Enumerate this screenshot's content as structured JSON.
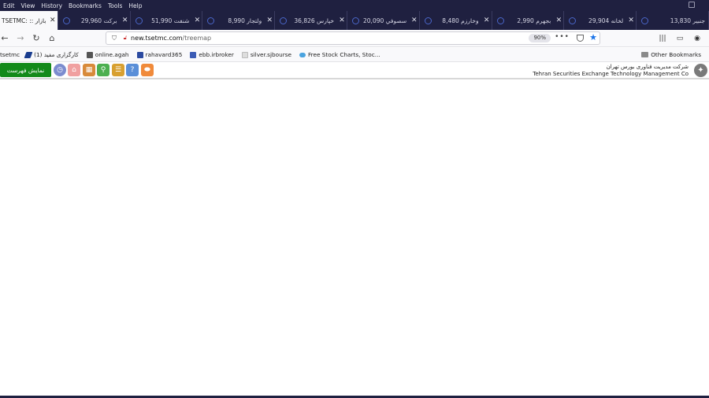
{
  "menu": [
    "Edit",
    "View",
    "History",
    "Bookmarks",
    "Tools",
    "Help"
  ],
  "tabs": [
    {
      "label": "TSETMC: :: بازار",
      "active": true
    },
    {
      "label": "برکت 29,960",
      "active": false
    },
    {
      "label": "شنفت 51,990",
      "active": false
    },
    {
      "label": "ولتجار 8,990",
      "active": false
    },
    {
      "label": "خپارس 36,826",
      "active": false
    },
    {
      "label": "سصوفي 20,090",
      "active": false
    },
    {
      "label": "وخارزم 8,480",
      "active": false
    },
    {
      "label": "بجهرم 2,990",
      "active": false
    },
    {
      "label": "لخانه 29,904",
      "active": false
    },
    {
      "label": "جنبير 13,830",
      "active": false
    }
  ],
  "nav": {
    "url_host": "new.tsetmc.com",
    "url_path": "/treemap",
    "zoom": "90%"
  },
  "bookmarks": [
    {
      "label": "tsetmc",
      "color": "#ffffff"
    },
    {
      "label": "کارگزاری مفید (1)",
      "color": "#1a3d8f"
    },
    {
      "label": "online.agah",
      "color": "#555555"
    },
    {
      "label": "rahavard365",
      "color": "#2b4aa0"
    },
    {
      "label": "ebb.irbroker",
      "color": "#3b5bb5"
    },
    {
      "label": "silver.sjbourse",
      "color": "#d8d8d8"
    },
    {
      "label": "Free Stock Charts, Stoc...",
      "color": "#4aa3df"
    }
  ],
  "other_bookmarks": "Other Bookmarks",
  "site": {
    "show_list": "نمایش فهرست",
    "company_fa": "شرکت مدیریت فناوری بورس تهران",
    "company_en": "Tehran Securities Exchange Technology Management Co"
  },
  "toolbar_icons": [
    {
      "name": "clock-icon",
      "color": "#7c8ccf",
      "glyph": "◷"
    },
    {
      "name": "home-icon",
      "color": "#f0a0a0",
      "glyph": "⌂"
    },
    {
      "name": "calculator-icon",
      "color": "#d88a3a",
      "glyph": "▦"
    },
    {
      "name": "search-icon",
      "color": "#4caf50",
      "glyph": "⚲"
    },
    {
      "name": "message-icon",
      "color": "#d8a030",
      "glyph": "☰"
    },
    {
      "name": "help-icon",
      "color": "#5a8fd8",
      "glyph": "?"
    },
    {
      "name": "logo-icon",
      "color": "#f08a3a",
      "glyph": "⬬"
    }
  ]
}
